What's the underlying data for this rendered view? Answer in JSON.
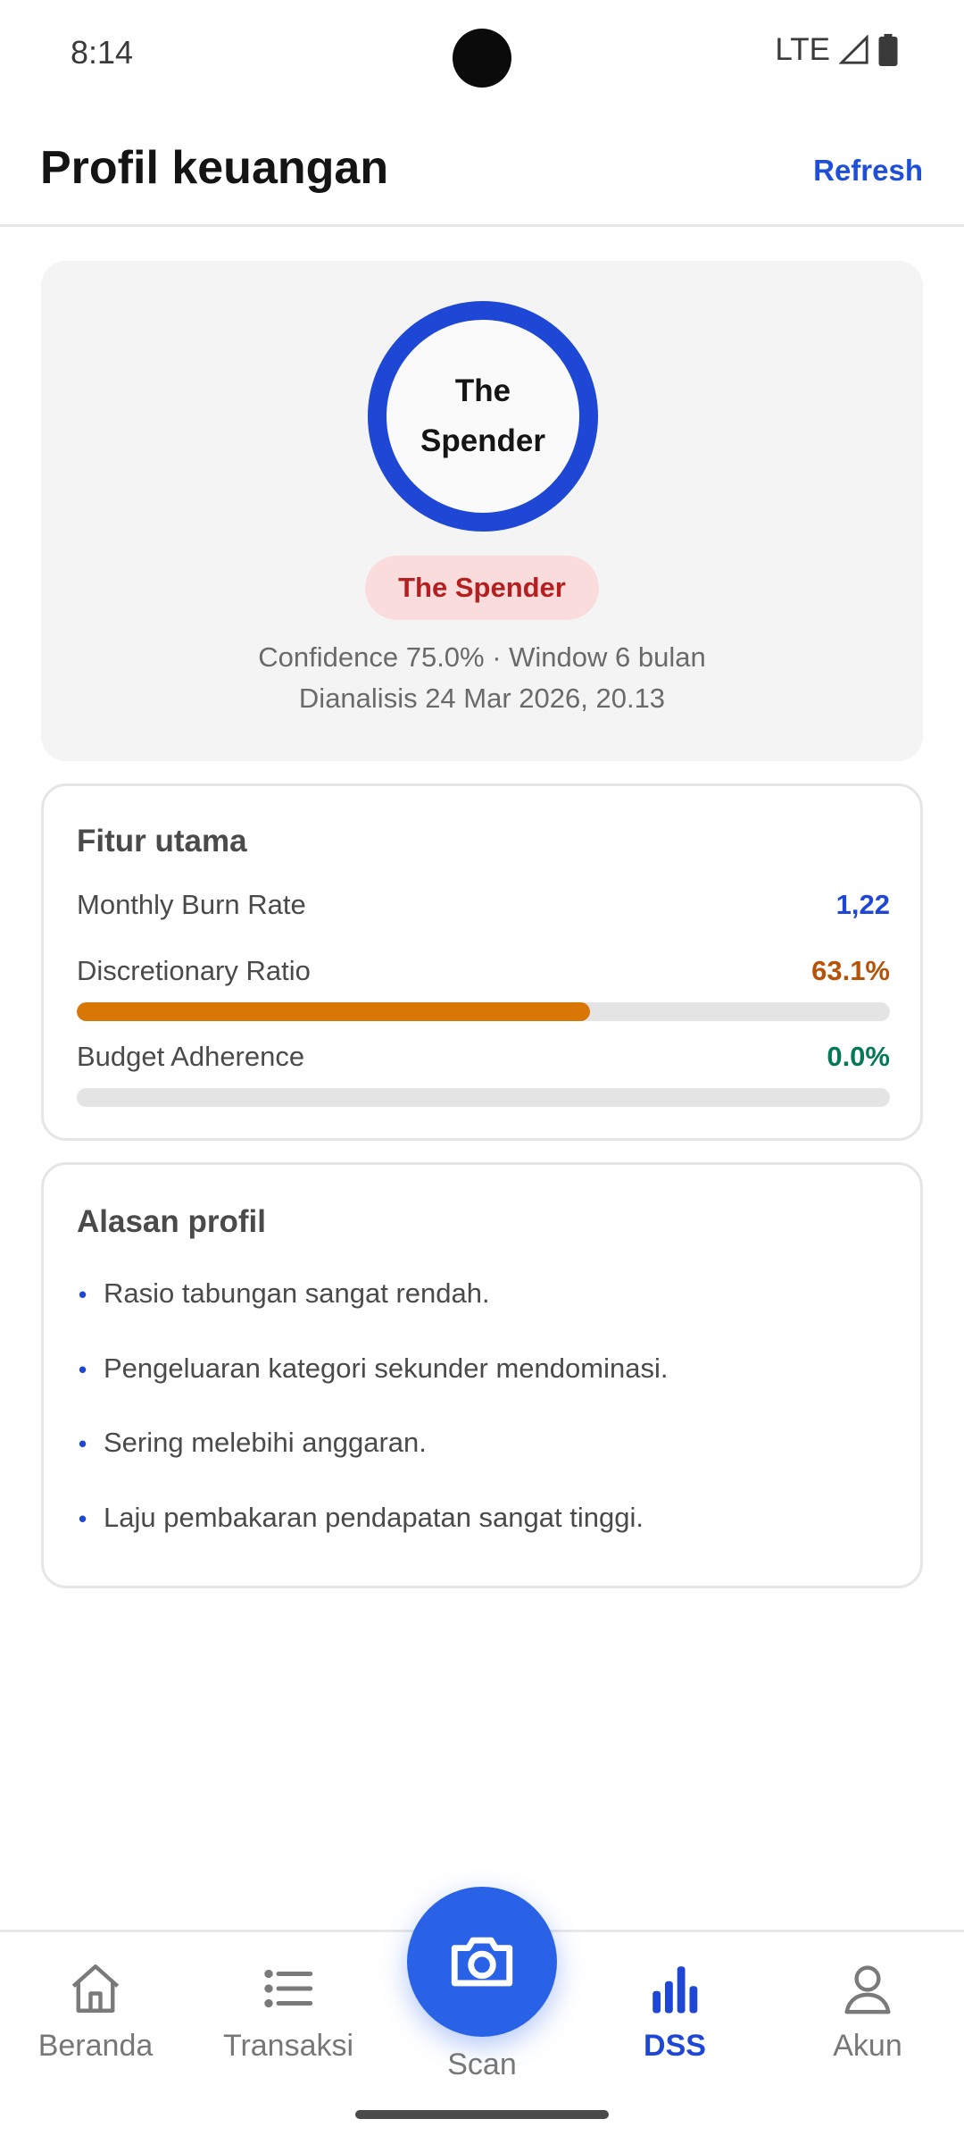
{
  "status_bar": {
    "time": "8:14",
    "network": "LTE"
  },
  "header": {
    "title": "Profil keuangan",
    "refresh_label": "Refresh"
  },
  "profile": {
    "ring_label": "The Spender",
    "badge_label": "The Spender",
    "confidence_line": "Confidence 75.0% · Window 6 bulan",
    "analyzed_line": "Dianalisis 24 Mar 2026, 20.13"
  },
  "features": {
    "title": "Fitur utama",
    "items": [
      {
        "label": "Monthly Burn Rate",
        "value": "1,22",
        "color": "#1e47d6"
      },
      {
        "label": "Discretionary Ratio",
        "value": "63.1%",
        "color": "#b45309",
        "progress": 0.631
      },
      {
        "label": "Budget Adherence",
        "value": "0.0%",
        "color": "#047857",
        "progress": 0.0
      }
    ]
  },
  "reasons": {
    "title": "Alasan profil",
    "items": [
      "Rasio tabungan sangat rendah.",
      "Pengeluaran kategori sekunder mendominasi.",
      "Sering melebihi anggaran.",
      "Laju pembakaran pendapatan sangat tinggi."
    ]
  },
  "nav": {
    "beranda": "Beranda",
    "transaksi": "Transaksi",
    "scan": "Scan",
    "dss": "DSS",
    "akun": "Akun",
    "active": "dss"
  },
  "colors": {
    "accent": "#1e47d6",
    "scan_button": "#2962e6",
    "spender_badge_bg": "#fbdcdc",
    "spender_badge_text": "#b3201f",
    "bar_fill": "#d97706"
  }
}
